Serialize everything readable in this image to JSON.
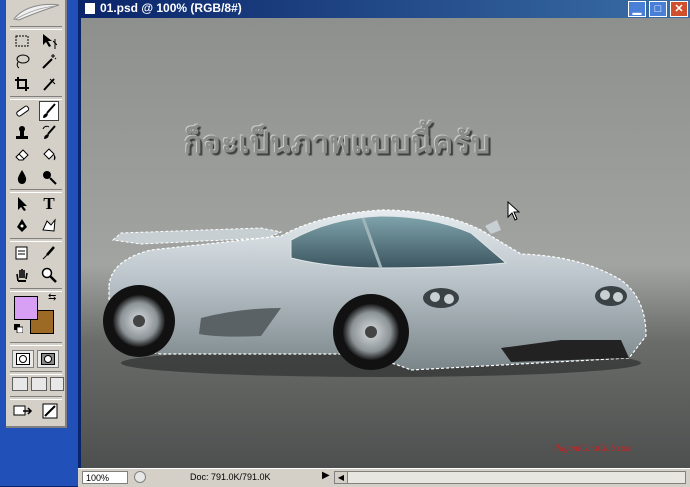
{
  "document": {
    "title": "01.psd @ 100% (RGB/8#)",
    "window_buttons": [
      "minimize",
      "maximize",
      "close"
    ]
  },
  "canvas": {
    "overlay_text": "ก็จะเป็นภาพแบบนี้ครับ",
    "watermark": "PaganiCarsClub.com"
  },
  "status_bar": {
    "zoom": "100%",
    "doc_size": "Doc: 791.0K/791.0K"
  },
  "toolbox": {
    "foreground_color": "#d8a0f4",
    "background_color": "#9c6a24",
    "active_tool": "brush-tool",
    "tools": [
      "marquee-tool",
      "move-tool",
      "lasso-tool",
      "magic-wand-tool",
      "crop-tool",
      "slice-tool",
      "healing-brush-tool",
      "brush-tool",
      "clone-stamp-tool",
      "history-brush-tool",
      "eraser-tool",
      "paint-bucket-tool",
      "blur-tool",
      "dodge-tool",
      "path-selection-tool",
      "type-tool",
      "pen-tool",
      "custom-shape-tool",
      "notes-tool",
      "eyedropper-tool",
      "hand-tool",
      "zoom-tool"
    ]
  },
  "colors": {
    "titlebar_start": "#0a246a",
    "titlebar_end": "#3a6ea5",
    "toolbox_frame": "#2050b8"
  }
}
